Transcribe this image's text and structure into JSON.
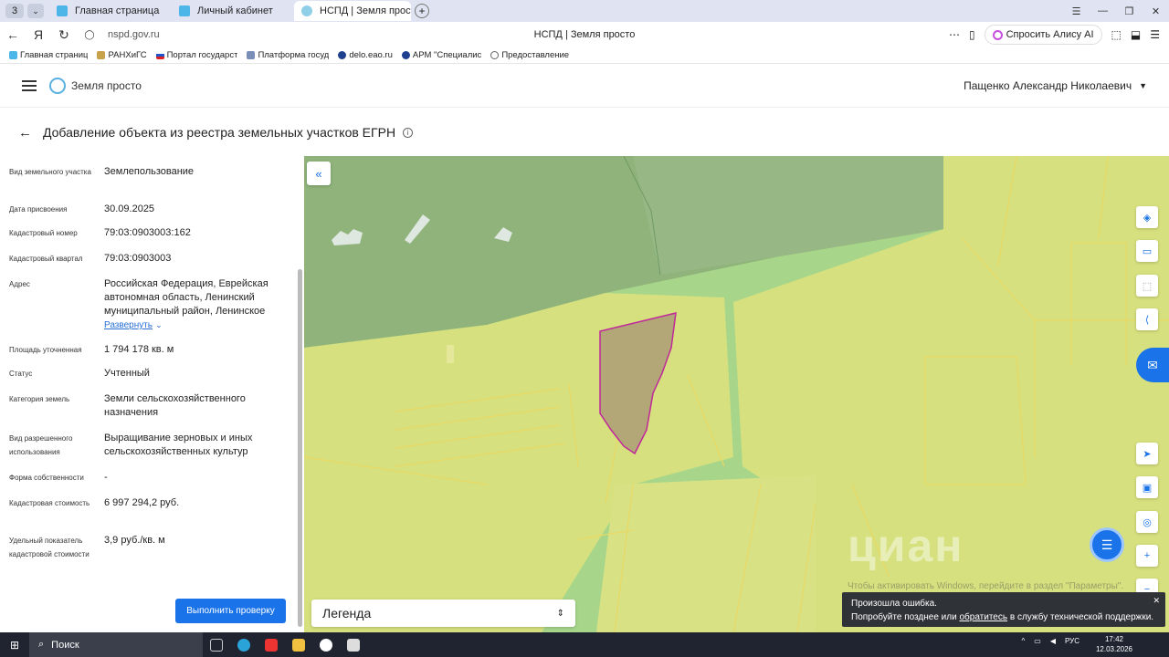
{
  "browser": {
    "tab_counter": "3",
    "tabs": [
      {
        "title": "Главная страница",
        "active": false
      },
      {
        "title": "Личный кабинет",
        "active": false
      },
      {
        "title": "НСПД | Земля просто",
        "active": true
      }
    ],
    "url": "nspd.gov.ru",
    "page_title": "НСПД | Земля просто",
    "alisa_label": "Спросить Алису AI",
    "bookmarks": [
      "Главная страниц",
      "РАНХиГС",
      "Портал государст",
      "Платформа госуд",
      "delo.eao.ru",
      "АРМ \"Специалис",
      "Предоставление"
    ]
  },
  "header": {
    "app_name": "Земля просто",
    "user_name": "Пащенко Александр Николаевич"
  },
  "page": {
    "title": "Добавление объекта из реестра земельных участков ЕГРН"
  },
  "properties": [
    {
      "label": "Вид земельного участка",
      "value": "Землепользование"
    },
    {
      "label": "Дата присвоения",
      "value": "30.09.2025"
    },
    {
      "label": "Кадастровый номер",
      "value": "79:03:0903003:162"
    },
    {
      "label": "Кадастровый квартал",
      "value": "79:03:0903003"
    },
    {
      "label": "Адрес",
      "value": "Российская Федерация, Еврейская автономная область, Ленинский муниципальный район, Ленинское"
    },
    {
      "label": "Площадь уточненная",
      "value": "1 794 178 кв. м"
    },
    {
      "label": "Статус",
      "value": "Учтенный"
    },
    {
      "label": "Категория земель",
      "value": "Земли сельскохозяйственного назначения"
    },
    {
      "label": "Вид разрешенного использования",
      "value": "Выращивание зерновых и иных сельскохозяйственных культур"
    },
    {
      "label": "Форма собственности",
      "value": "-"
    },
    {
      "label": "Кадастровая стоимость",
      "value": "6 997 294,2 руб."
    },
    {
      "label": "Удельный показатель кадастровой стоимости",
      "value": "3,9 руб./кв. м"
    }
  ],
  "expand_label": "Развернуть",
  "check_button": "Выполнить проверку",
  "map": {
    "legend_label": "Легенда",
    "watermark": "циан",
    "activate_text": "Чтобы активировать Windows, перейдите в раздел \"Параметры\"."
  },
  "toast": {
    "title": "Произошла ошибка.",
    "text_before": "Попробуйте позднее или ",
    "link": "обратитесь",
    "text_after": " в службу технической поддержки."
  },
  "taskbar": {
    "search": "Поиск",
    "lang": "РУС",
    "time": "17:42",
    "date": "12.03.2026"
  }
}
